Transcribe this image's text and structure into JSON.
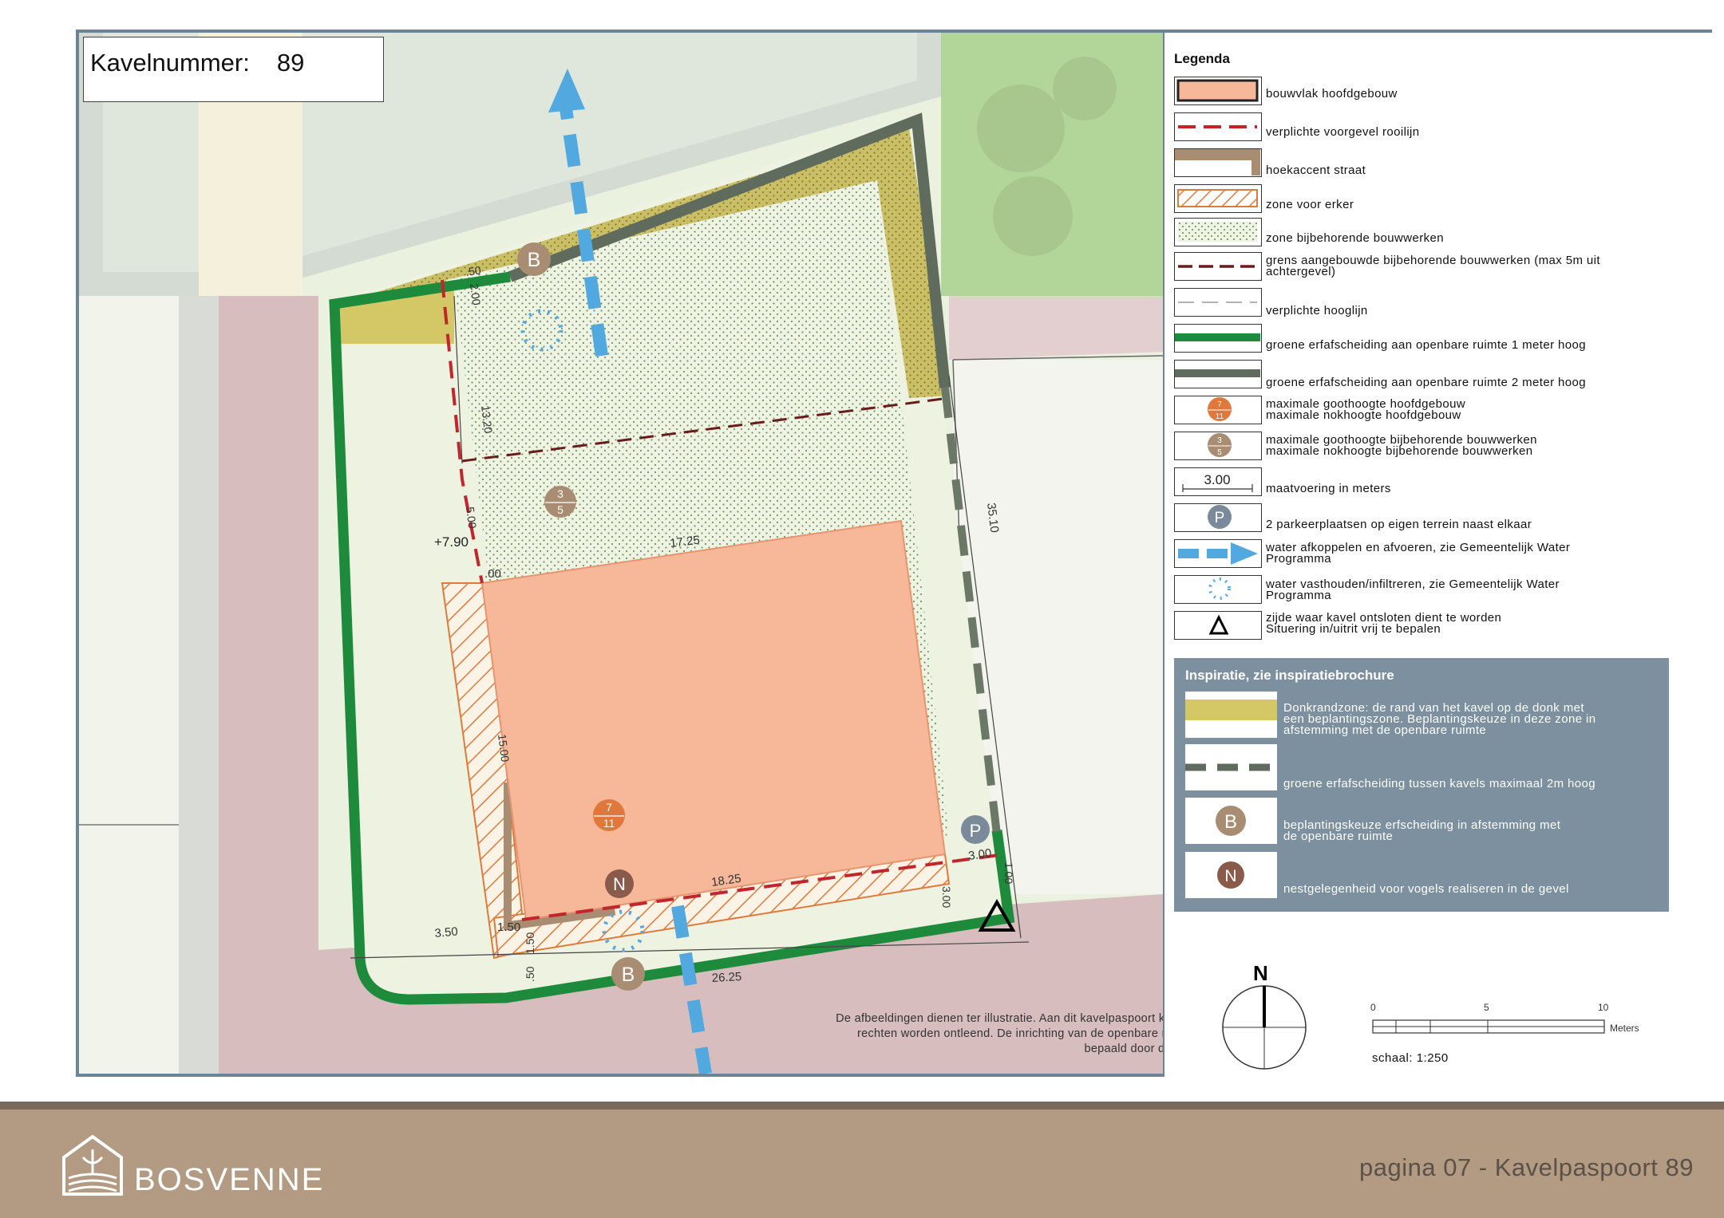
{
  "kavel": {
    "label": "Kavelnummer:",
    "number": "89"
  },
  "map": {
    "dimensions": {
      "d200": "2.00",
      "d1320": "13.20",
      "d500": "5.00",
      "d3510": "35.10",
      "d1725": "17.25",
      "d_00": ".00",
      "d1500": "15.00",
      "d1825": "18.25",
      "d350": "3.50",
      "d150a": "1.50",
      "d150b": "1.50",
      "d150c": ".50",
      "d2625": "26.25",
      "d300a": "3.00",
      "d300b": "3.00",
      "d100": "1.00",
      "d_50": ".50"
    },
    "height_label": "+7.90",
    "bij_height": {
      "goot": "3",
      "nok": "5"
    },
    "hoofd_height": {
      "goot": "7",
      "nok": "11"
    },
    "symbols": {
      "b": "B",
      "n": "N",
      "p": "P"
    }
  },
  "disclaimer": "De afbeeldingen dienen ter illustratie. Aan dit kavelpaspoort kunnen geen\nrechten worden ontleend. De inrichting van de openbare ruimte wordt\nbepaald door de gemeente",
  "legend": {
    "title": "Legenda",
    "items": [
      {
        "key": "bouwvlak",
        "text": "bouwvlak hoofdgebouw"
      },
      {
        "key": "rooilijn",
        "text": "verplichte voorgevel rooilijn"
      },
      {
        "key": "hoekaccent",
        "text": "hoekaccent straat"
      },
      {
        "key": "erker",
        "text": "zone voor erker"
      },
      {
        "key": "bijbehorend",
        "text": "zone bijbehorende bouwwerken"
      },
      {
        "key": "grens",
        "text": "grens aangebouwde bijbehorende bouwwerken (max 5m uit\nachtergevel)"
      },
      {
        "key": "hoogtelijn",
        "text": "verplichte hooglijn"
      },
      {
        "key": "groen1",
        "text": "groene erfafscheiding aan openbare ruimte 1 meter hoog"
      },
      {
        "key": "groen2",
        "text": "groene erfafscheiding aan openbare ruimte 2 meter hoog"
      },
      {
        "key": "hoofdhoogte",
        "text": "maximale goothoogte hoofdgebouw\nmaximale nokhoogte hoofdgebouw"
      },
      {
        "key": "bijhoogte",
        "text": "maximale goothoogte bijbehorende bouwwerken\nmaximale nokhoogte bijbehorende bouwwerken"
      },
      {
        "key": "maat",
        "text": "maatvoering in meters"
      },
      {
        "key": "parkeren",
        "text": "2 parkeerplaatsen op eigen terrein naast elkaar"
      },
      {
        "key": "afkoppelen",
        "text": "water afkoppelen en afvoeren, zie Gemeentelijk Water\nProgramma"
      },
      {
        "key": "vasthouden",
        "text": "water vasthouden/infiltreren, zie Gemeentelijk Water\nProgramma"
      },
      {
        "key": "ontsluiting",
        "text": "zijde waar kavel ontsloten dient te worden\nSituering in/uitrit vrij te bepalen"
      }
    ],
    "swatch_labels": {
      "hoofd_goot": "7",
      "hoofd_nok": "11",
      "bij_goot": "3",
      "bij_nok": "5",
      "maat": "3.00",
      "p": "P"
    },
    "colors": {
      "bouwvlak": "#f7b89a",
      "rooilijn": "#c0262c",
      "hoekaccent": "#a98d73",
      "erker": "#e07a3c",
      "groen1": "#1e8a3c",
      "groen2": "#5f6b5c",
      "water": "#52a9e0",
      "donkrand": "#d4c766"
    }
  },
  "inspiratie": {
    "title": "Inspiratie, zie inspiratiebrochure",
    "items": [
      {
        "key": "donkrand",
        "text": "Donkrandzone: de rand van het kavel op de donk met\neen beplantingszone. Beplantingskeuze in deze zone in\nafstemming met de openbare ruimte"
      },
      {
        "key": "tussen",
        "text": "groene erfafscheiding tussen kavels maximaal 2m hoog"
      },
      {
        "key": "beplanting",
        "text": "beplantingskeuze erfscheiding in afstemming met\nde openbare ruimte"
      },
      {
        "key": "nest",
        "text": "nestgelegenheid voor vogels realiseren in de gevel"
      }
    ],
    "symbols": {
      "b": "B",
      "n": "N"
    }
  },
  "north": {
    "letter": "N"
  },
  "scale": {
    "ticks": [
      "0",
      "5",
      "10"
    ],
    "unit": "Meters",
    "text": "schaal: 1:250"
  },
  "footer": {
    "brand": "BOSVENNE",
    "page": "pagina 07 - Kavelpaspoort 89"
  }
}
